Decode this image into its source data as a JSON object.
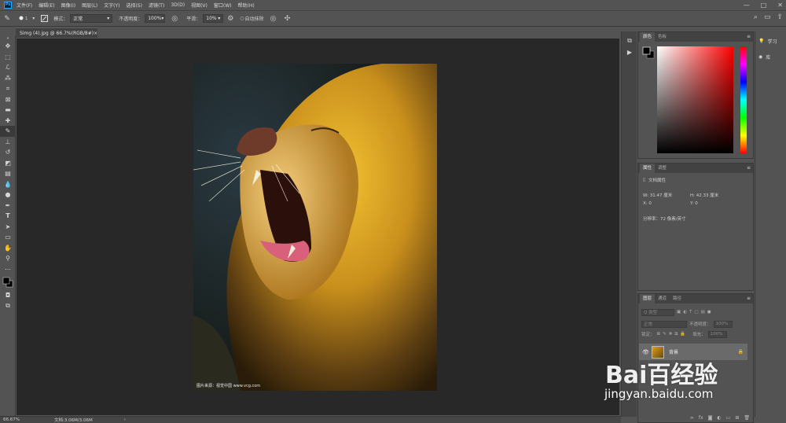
{
  "app": {
    "logo_text": "Ps"
  },
  "menu": [
    "文件(F)",
    "编辑(E)",
    "图像(I)",
    "图层(L)",
    "文字(Y)",
    "选择(S)",
    "滤镜(T)",
    "3D(D)",
    "视图(V)",
    "窗口(W)",
    "帮助(H)"
  ],
  "window_controls": {
    "minimize": "—",
    "maximize": "□",
    "close": "✕"
  },
  "options": {
    "brush_size": "1",
    "mode_label": "模式：",
    "mode_value": "正常",
    "opacity_label": "不透明度：",
    "opacity_value": "100%",
    "smooth_label": "平滑：",
    "smooth_value": "10%",
    "auto_erase_label": "自动抹除"
  },
  "document": {
    "tab_title": "Simg (4).jpg @ 66.7%(RGB/8#)",
    "tab_close": "×",
    "watermark": "图片来源：视觉中国 www.vcg.com"
  },
  "status": {
    "zoom": "66.67%",
    "doc_info": "文档:3.06M/3.06M",
    "arrow": "›"
  },
  "color_panel": {
    "tabs": [
      "颜色",
      "色板"
    ]
  },
  "properties_panel": {
    "tabs": [
      "属性",
      "调整"
    ],
    "doc_props": "文档属性",
    "w": "W: 31.47 厘米",
    "h": "H: 42.33 厘米",
    "x": "X: 0",
    "y": "Y: 0",
    "resolution": "分辨率：72 像素/英寸"
  },
  "layers_panel": {
    "tabs": [
      "图层",
      "通道",
      "路径"
    ],
    "kind_label": "Q 类型",
    "blend_mode": "正常",
    "opacity_label": "不透明度：",
    "opacity_value": "100%",
    "lock_label": "锁定：",
    "fill_label": "填充：",
    "fill_value": "100%",
    "layer_name": "背景"
  },
  "right_strip": {
    "learn": "学习",
    "libraries": "库"
  },
  "baidu": {
    "logo": "Bai百经验",
    "url": "jingyan.baidu.com"
  },
  "colors": {
    "accent": "#31a8ff",
    "bg": "#535353",
    "canvas": "#282828"
  }
}
